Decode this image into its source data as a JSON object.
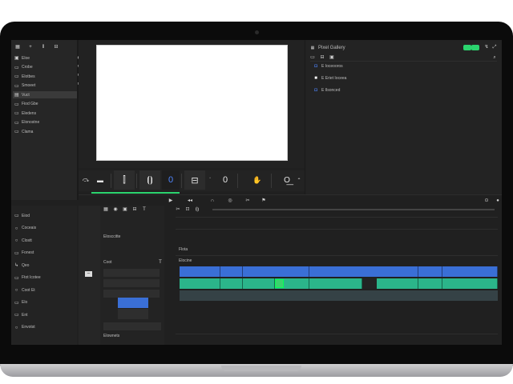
{
  "window": {
    "right_panel_title": "Pixel Gallery"
  },
  "sidebar_top": {
    "items": [
      {
        "label": "Eloe",
        "icon": "image-icon"
      },
      {
        "label": "Crobe",
        "icon": "folder-icon"
      },
      {
        "label": "Elotbes",
        "icon": "folder-icon"
      },
      {
        "label": "Smoeet",
        "icon": "folder-icon"
      },
      {
        "label": "Vuct",
        "icon": "film-icon",
        "selected": true
      },
      {
        "label": "Fiod Gbe",
        "icon": "folder-icon"
      },
      {
        "label": "Eledens",
        "icon": "folder-icon"
      },
      {
        "label": "Elonostne",
        "icon": "folder-icon"
      },
      {
        "label": "Clama",
        "icon": "folder-icon"
      }
    ]
  },
  "sidebar_bottom": {
    "items": [
      {
        "label": "Eiod",
        "icon": "folder-icon"
      },
      {
        "label": "Coceais",
        "icon": "circle-icon"
      },
      {
        "label": "Clostt",
        "icon": "circle-icon"
      },
      {
        "label": "Fonest",
        "icon": "folder-icon"
      },
      {
        "label": "Qeo",
        "icon": "arrow-icon"
      },
      {
        "label": "Ftot Icotee",
        "icon": "folder-icon"
      },
      {
        "label": "Coot Et",
        "icon": "circle-icon"
      },
      {
        "label": "Elo",
        "icon": "folder-icon"
      },
      {
        "label": "Ent",
        "icon": "folder-icon"
      },
      {
        "label": "Envotst",
        "icon": "circle-icon"
      }
    ]
  },
  "media_browser": {
    "items": [
      {
        "label": "E Ioceooros"
      },
      {
        "label": "E Eriet Ioceea"
      },
      {
        "label": "E Ilsonced"
      }
    ]
  },
  "viewer_toolbar": {
    "timecode_digit": "0",
    "timecode_digit2": "0"
  },
  "timeline": {
    "left_label_1": "Elosccitte",
    "left_label_2": "Coot",
    "left_label_3": "Elownets",
    "track_header_1": "Flota",
    "track_header_2": "Elocine"
  },
  "colors": {
    "accent_green": "#2bd46e",
    "clip_blue": "#3a6fd6",
    "clip_green": "#2bb58a"
  }
}
